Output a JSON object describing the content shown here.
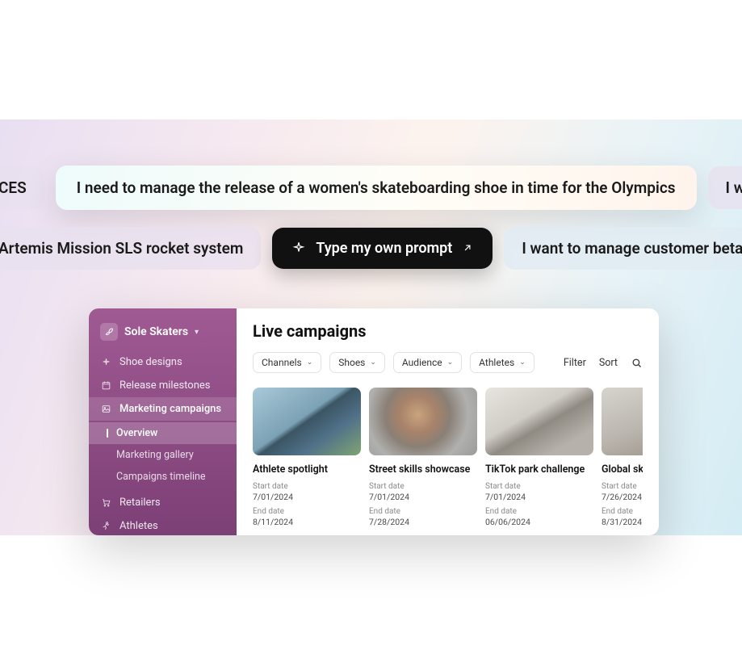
{
  "promptRow1": {
    "left": "CES",
    "highlight": "I need to manage the release of a women's skateboarding shoe in time for the Olympics",
    "right": "I war"
  },
  "promptRow2": {
    "left": "Artemis Mission SLS rocket system",
    "typeOwn": "Type my own prompt",
    "right": "I want to manage customer beta p"
  },
  "sidebar": {
    "workspace": "Sole Skaters",
    "items": [
      {
        "label": "Shoe designs"
      },
      {
        "label": "Release milestones"
      },
      {
        "label": "Marketing campaigns"
      },
      {
        "label": "Retailers"
      },
      {
        "label": "Athletes"
      }
    ],
    "sub": {
      "overview": "Overview",
      "gallery": "Marketing gallery",
      "timeline": "Campaigns timeline"
    }
  },
  "main": {
    "title": "Live campaigns",
    "filters": {
      "channels": "Channels",
      "shoes": "Shoes",
      "audience": "Audience",
      "athletes": "Athletes"
    },
    "controls": {
      "filter": "Filter",
      "sort": "Sort"
    },
    "dateLabels": {
      "start": "Start date",
      "end": "End date"
    },
    "cards": [
      {
        "title": "Athlete spotlight",
        "start": "7/01/2024",
        "end": "8/11/2024"
      },
      {
        "title": "Street skills showcase",
        "start": "7/01/2024",
        "end": "7/28/2024"
      },
      {
        "title": "TikTok park challenge",
        "start": "7/01/2024",
        "end": "06/06/2024"
      },
      {
        "title": "Global skatebo",
        "start": "7/26/2024",
        "end": "8/31/2024"
      }
    ]
  }
}
